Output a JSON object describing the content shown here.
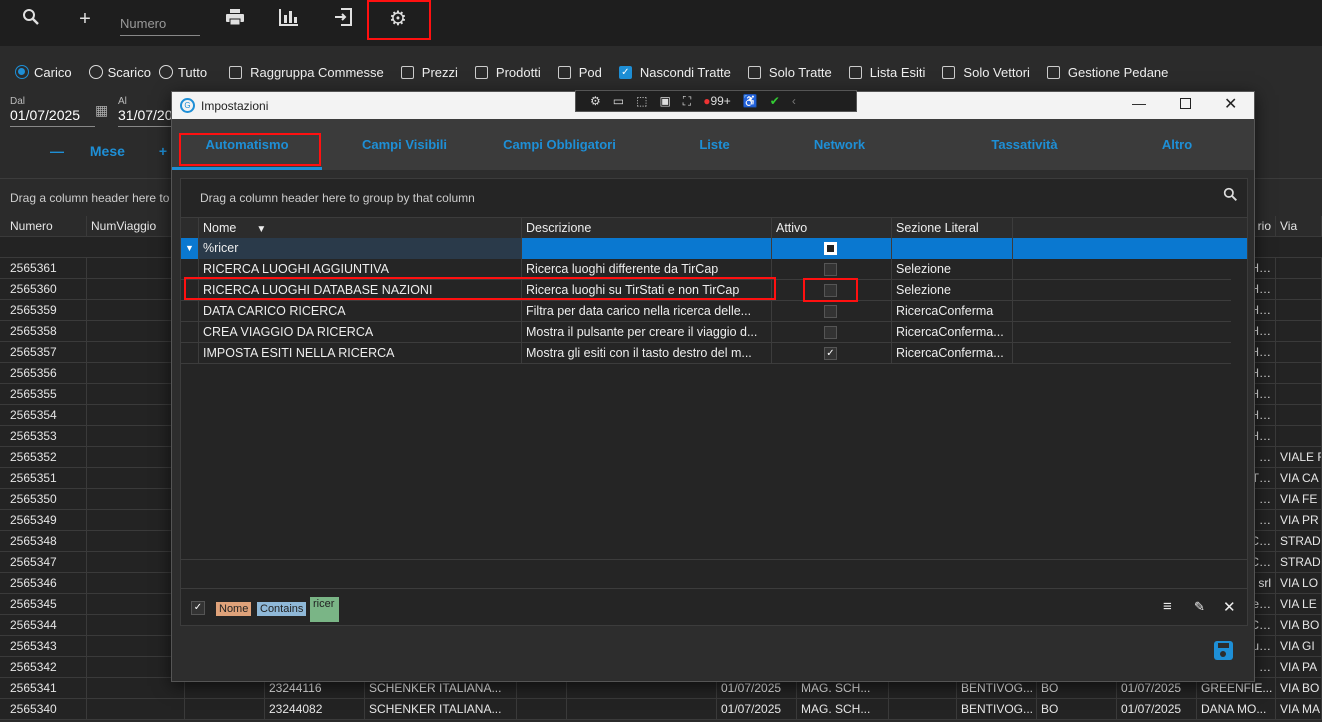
{
  "toolbar": {
    "numero_placeholder": "Numero",
    "icons": [
      "search-icon",
      "plus-icon",
      "printer-icon",
      "chart-icon",
      "logout-icon",
      "gear-icon"
    ]
  },
  "options": {
    "radios": [
      {
        "label": "Carico",
        "on": true
      },
      {
        "label": "Scarico",
        "on": false
      },
      {
        "label": "Tutto",
        "on": false
      }
    ],
    "checks": [
      {
        "label": "Raggruppa Commesse",
        "on": false
      },
      {
        "label": "Prezzi",
        "on": false
      },
      {
        "label": "Prodotti",
        "on": false
      },
      {
        "label": "Pod",
        "on": false
      },
      {
        "label": "Nascondi Tratte",
        "on": true
      },
      {
        "label": "Solo Tratte",
        "on": false
      },
      {
        "label": "Lista Esiti",
        "on": false
      },
      {
        "label": "Solo Vettori",
        "on": false
      },
      {
        "label": "Gestione Pedane",
        "on": false
      }
    ]
  },
  "dates": {
    "dal_label": "Dal",
    "dal": "01/07/2025",
    "al_label": "Al",
    "al": "31/07/2025"
  },
  "period": {
    "minus": "—",
    "label": "Mese",
    "plus": "+"
  },
  "bg_grid": {
    "drag_hint": "Drag a column header here to group by that column",
    "headers": {
      "numero": "Numero",
      "numviaggio": "NumViaggio",
      "partial": "rio",
      "via": "Via"
    },
    "rows": [
      {
        "numero": "2565361",
        "c": "H…",
        "via": ""
      },
      {
        "numero": "2565360",
        "c": "H…",
        "via": ""
      },
      {
        "numero": "2565359",
        "c": "H…",
        "via": ""
      },
      {
        "numero": "2565358",
        "c": "H…",
        "via": ""
      },
      {
        "numero": "2565357",
        "c": "H…",
        "via": ""
      },
      {
        "numero": "2565356",
        "c": "H…",
        "via": ""
      },
      {
        "numero": "2565355",
        "c": "H…",
        "via": ""
      },
      {
        "numero": "2565354",
        "c": "H…",
        "via": ""
      },
      {
        "numero": "2565353",
        "c": "H…",
        "via": ""
      },
      {
        "numero": "2565352",
        "c": "…",
        "via": "VIALE F"
      },
      {
        "numero": "2565351",
        "c": "T…",
        "via": "VIA CA"
      },
      {
        "numero": "2565350",
        "c": "…",
        "via": "VIA FE"
      },
      {
        "numero": "2565349",
        "c": "…",
        "via": "VIA PR"
      },
      {
        "numero": "2565348",
        "c": "C…",
        "via": "STRAD"
      },
      {
        "numero": "2565347",
        "c": "C…",
        "via": "STRAD"
      },
      {
        "numero": "2565346",
        "c": "srl",
        "via": "VIA LO"
      },
      {
        "numero": "2565345",
        "c": "e…",
        "via": "VIA LE"
      },
      {
        "numero": "2565344",
        "c": "C…",
        "via": "VIA BO"
      },
      {
        "numero": "2565343",
        "c": "u…",
        "via": "VIA GI"
      },
      {
        "numero": "2565342",
        "c": "…",
        "via": "VIA PA"
      }
    ],
    "full_rows": [
      {
        "numero": "2565341",
        "v": "23244116",
        "mitt": "SCHENKER ITALIANA...",
        "data": "01/07/2025",
        "mag": "MAG. SCH...",
        "loc": "BENTIVOG...",
        "prov": "BO",
        "data2": "01/07/2025",
        "dest": "GREENFIE...",
        "via": "VIA BO"
      },
      {
        "numero": "2565340",
        "v": "23244082",
        "mitt": "SCHENKER ITALIANA...",
        "data": "01/07/2025",
        "mag": "MAG. SCH...",
        "loc": "BENTIVOG...",
        "prov": "BO",
        "data2": "01/07/2025",
        "dest": "DANA MO...",
        "via": "VIA MA"
      }
    ]
  },
  "dialog": {
    "title": "Impostazioni",
    "badge": "99+",
    "tabs": [
      "Automatismo",
      "Campi Visibili",
      "Campi Obbligatori",
      "Liste",
      "Network",
      "Tassatività",
      "Altro"
    ],
    "drag_hint": "Drag a column header here to group by that column",
    "columns": [
      "Nome",
      "Descrizione",
      "Attivo",
      "Sezione Literal"
    ],
    "filter_value": "%ricer",
    "rows": [
      {
        "nome": "RICERCA LUOGHI AGGIUNTIVA",
        "descr": "Ricerca luoghi differente da TirCap",
        "attivo": false,
        "sezione": "Selezione"
      },
      {
        "nome": "RICERCA LUOGHI DATABASE NAZIONI",
        "descr": "Ricerca luoghi su TirStati e non TirCap",
        "attivo": false,
        "sezione": "Selezione"
      },
      {
        "nome": "DATA CARICO RICERCA",
        "descr": "Filtra per data carico nella ricerca delle...",
        "attivo": false,
        "sezione": "RicercaConferma"
      },
      {
        "nome": "CREA VIAGGIO DA RICERCA",
        "descr": "Mostra il pulsante per creare il viaggio d...",
        "attivo": false,
        "sezione": "RicercaConferma..."
      },
      {
        "nome": "IMPOSTA ESITI NELLA RICERCA",
        "descr": "Mostra gli esiti con il tasto destro del m...",
        "attivo": true,
        "sezione": "RicercaConferma..."
      }
    ],
    "filter_panel": {
      "field": "Nome",
      "op": "Contains",
      "value": "ricer"
    },
    "colors": {
      "accent": "#1e8fd6",
      "highlight": "#ff1010"
    }
  }
}
